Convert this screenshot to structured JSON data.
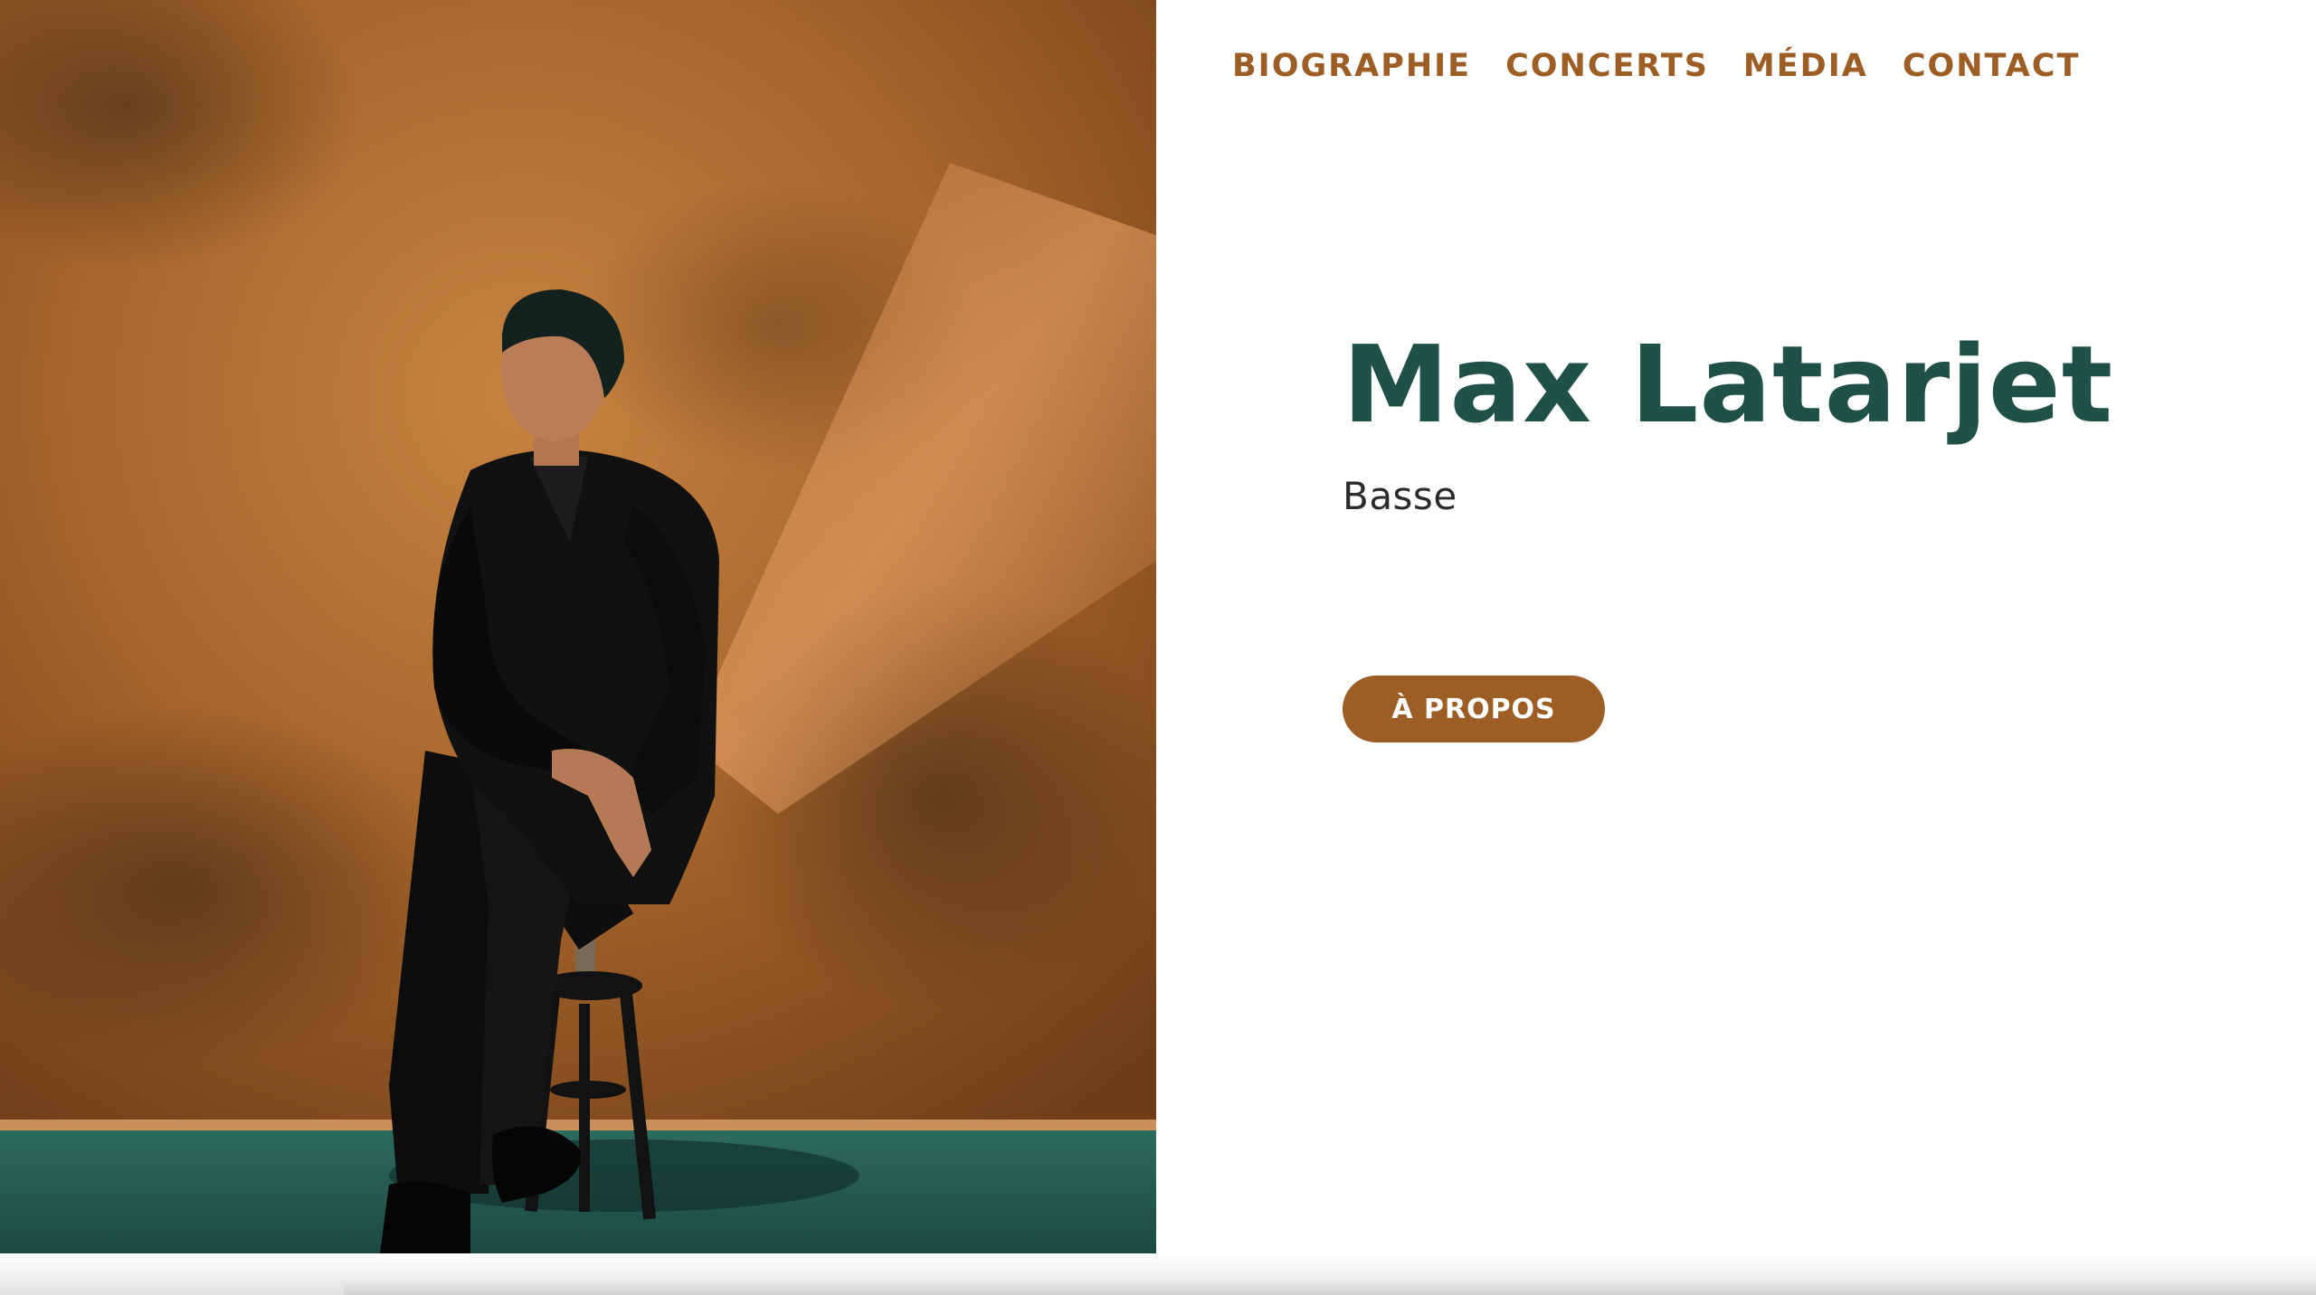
{
  "nav": {
    "items": [
      {
        "label": "BIOGRAPHIE"
      },
      {
        "label": "CONCERTS"
      },
      {
        "label": "MÉDIA"
      },
      {
        "label": "CONTACT"
      }
    ]
  },
  "hero": {
    "name": "Max Latarjet",
    "role": "Basse",
    "button_label": "À PROPOS",
    "photo_description_icon": "portrait-photo"
  },
  "colors": {
    "accent_brown": "#9c5e25",
    "title_green": "#1f5147",
    "text_dark": "#2b2b2b",
    "background": "#ffffff"
  }
}
